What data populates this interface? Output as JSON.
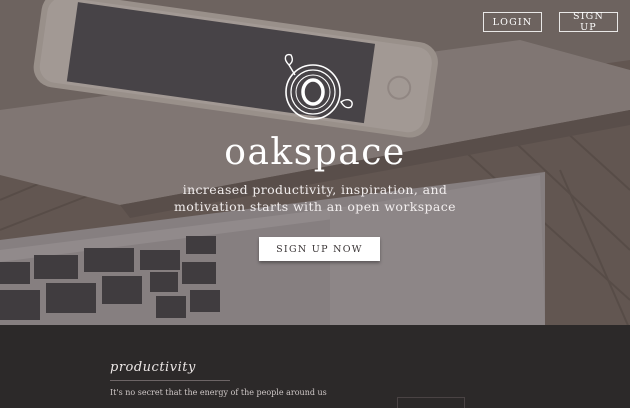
{
  "nav": {
    "login_label": "LOGIN",
    "signup_label": "SIGN UP"
  },
  "hero": {
    "brand": "oakspace",
    "tagline_line1": "increased productivity, inspiration, and",
    "tagline_line2": "motivation starts with an open workspace",
    "cta_label": "SIGN UP NOW",
    "logo_icon": "oak-ring-leaf-logo-icon"
  },
  "section": {
    "heading": "productivity",
    "body_line1": "It's no secret that the energy of the people around us",
    "body_line2": ""
  },
  "colors": {
    "hero_overlay": "#58504f",
    "section_bg": "#2c2929",
    "cta_bg": "#ffffff",
    "cta_text": "#3a3536"
  }
}
